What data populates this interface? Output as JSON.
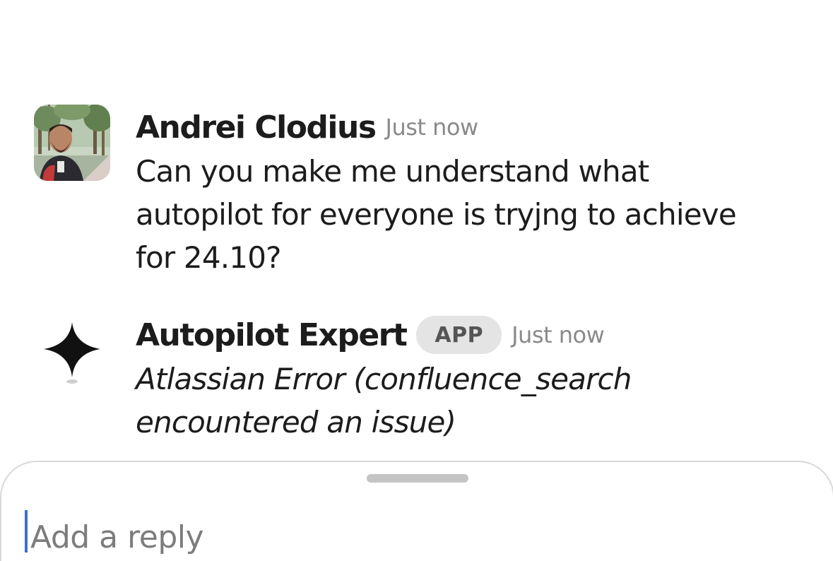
{
  "messages": [
    {
      "author": "Andrei Clodius",
      "time": "Just now",
      "lines": [
        "Can you make me understand what",
        "autopilot for everyone is tryjng to achieve",
        "for 24.10?"
      ],
      "avatar": "user-photo-avatar"
    },
    {
      "author": "Autopilot Expert",
      "badge": "APP",
      "time": "Just now",
      "lines": [
        "Atlassian Error (confluence_search",
        "encountered an issue)"
      ],
      "avatar": "sparkle-star-icon"
    }
  ],
  "composer": {
    "placeholder": "Add a reply"
  },
  "colors": {
    "text": "#1d1c1d",
    "muted": "#8a8a8a",
    "badge_bg": "#e4e4e4",
    "cursor": "#3b6fd6"
  }
}
